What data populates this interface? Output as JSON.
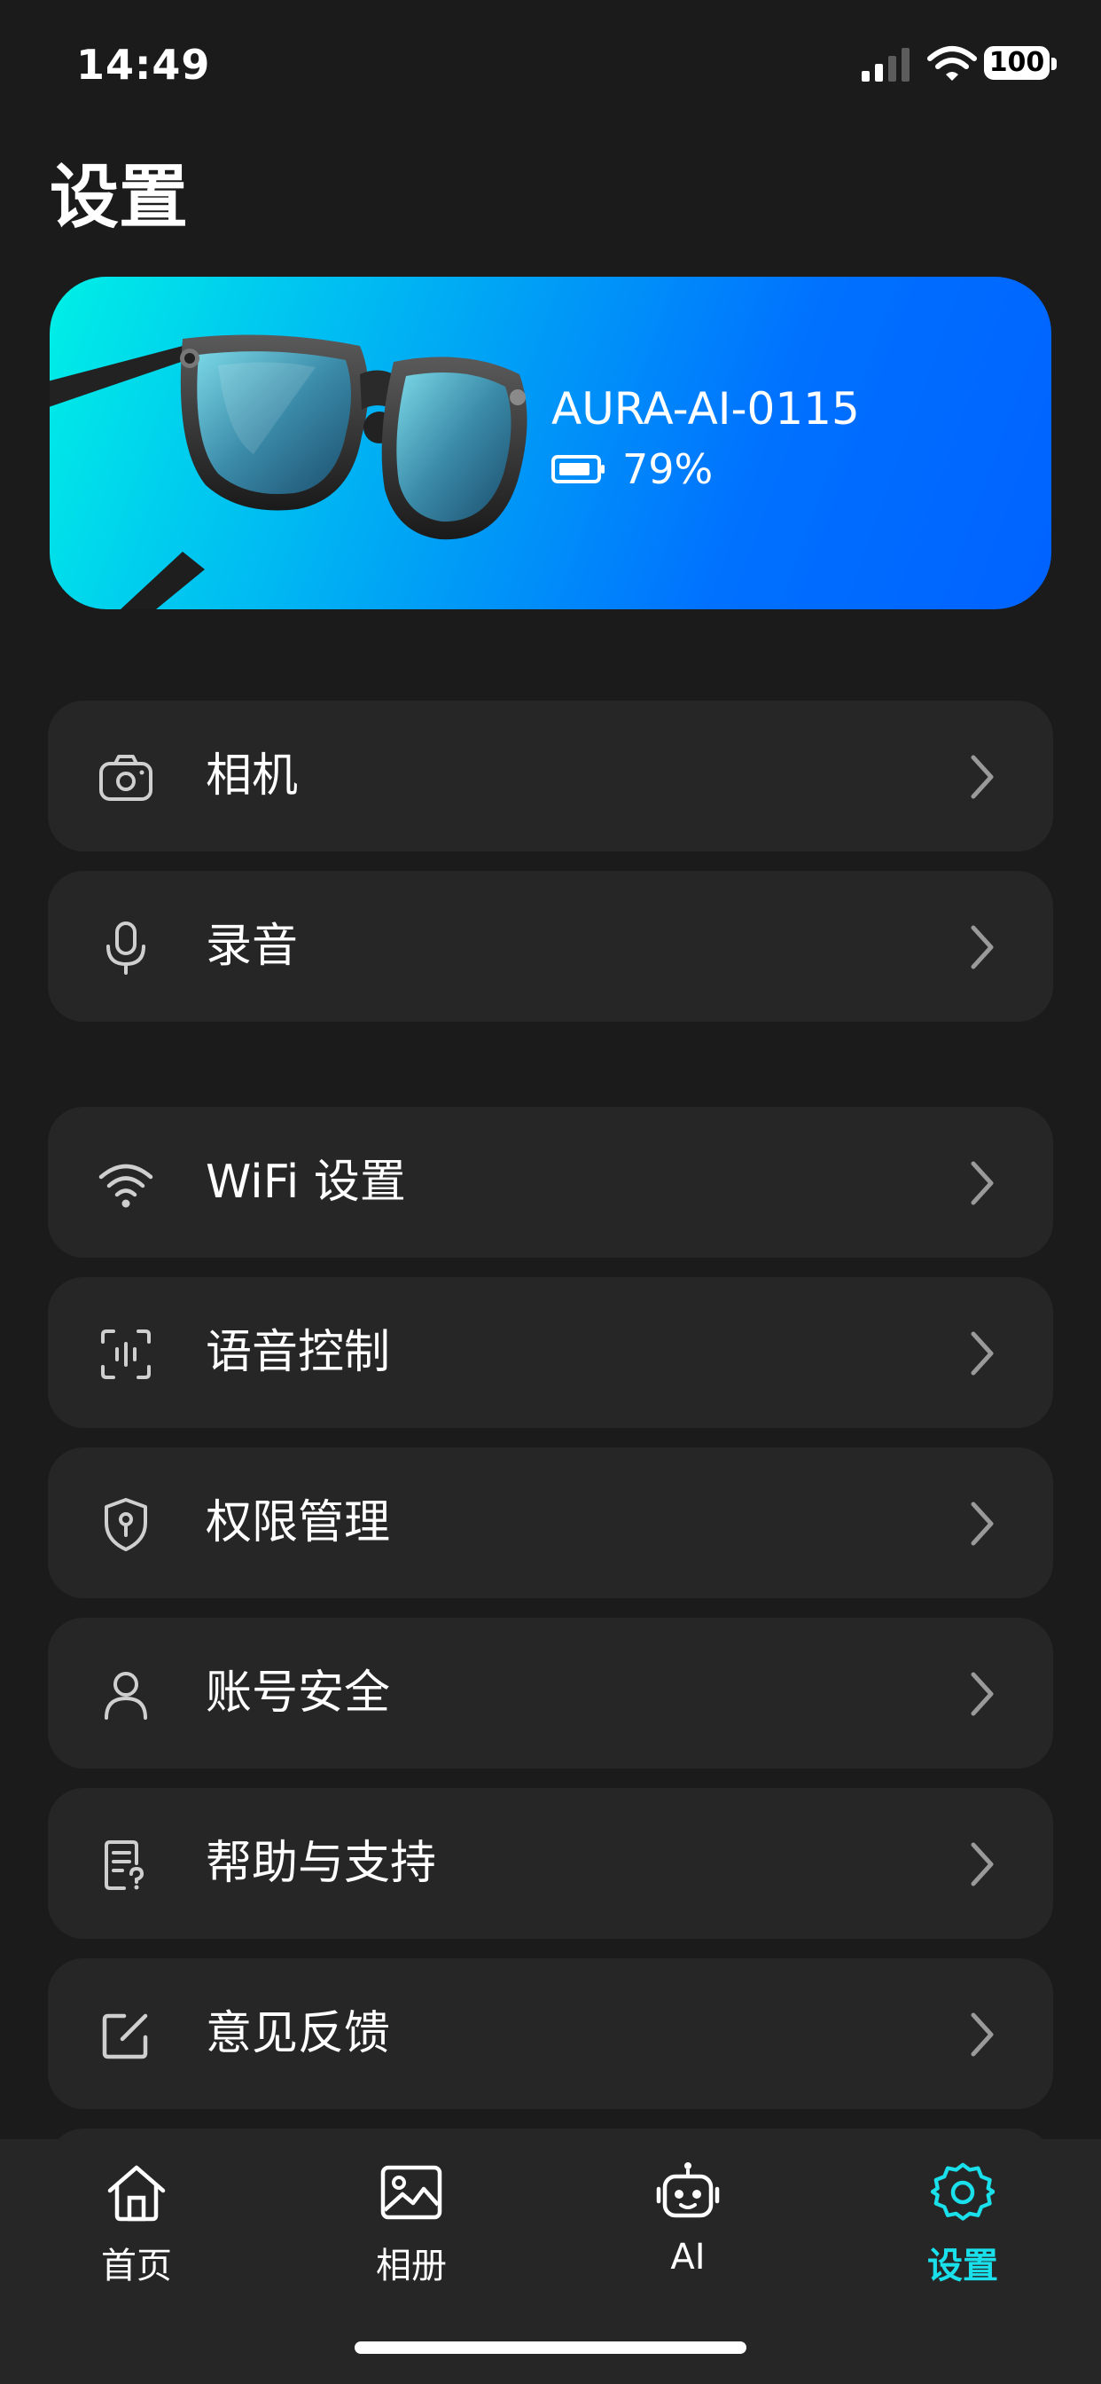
{
  "status_bar": {
    "time": "14:49",
    "battery": "100"
  },
  "page": {
    "title": "设置"
  },
  "device": {
    "name": "AURA-AI-0115",
    "battery": "79%"
  },
  "menu": {
    "group1": [
      {
        "label": "相机",
        "icon": "camera-icon"
      },
      {
        "label": "录音",
        "icon": "microphone-icon"
      }
    ],
    "group2": [
      {
        "label": "WiFi 设置",
        "icon": "wifi-icon"
      },
      {
        "label": "语音控制",
        "icon": "voice-control-icon"
      },
      {
        "label": "权限管理",
        "icon": "shield-key-icon"
      },
      {
        "label": "账号安全",
        "icon": "user-icon"
      },
      {
        "label": "帮助与支持",
        "icon": "help-document-icon"
      },
      {
        "label": "意见反馈",
        "icon": "feedback-edit-icon"
      }
    ]
  },
  "tabs": [
    {
      "label": "首页",
      "icon": "home-icon",
      "active": false
    },
    {
      "label": "相册",
      "icon": "image-icon",
      "active": false
    },
    {
      "label": "AI",
      "icon": "robot-icon",
      "active": false
    },
    {
      "label": "设置",
      "icon": "gear-icon",
      "active": true
    }
  ],
  "colors": {
    "accent": "#19e0ea",
    "background": "#1b1b1b",
    "card": "#262626",
    "gradient_start": "#00f0e6",
    "gradient_end": "#0062ff"
  }
}
